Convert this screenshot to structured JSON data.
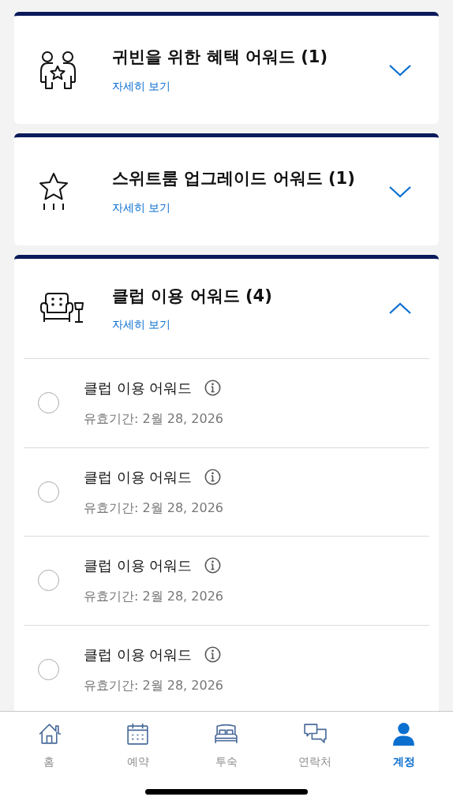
{
  "award_groups": [
    {
      "title": "귀빈을 위한 혜택 어워드 (1)",
      "link": "자세히 보기",
      "expanded": false
    },
    {
      "title": "스위트룸 업그레이드 어워드 (1)",
      "link": "자세히 보기",
      "expanded": false
    },
    {
      "title": "클럽 이용 어워드 (4)",
      "link": "자세히 보기",
      "expanded": true,
      "items": [
        {
          "name": "클럽 이용 어워드",
          "validity": "유효기간: 2월 28, 2026",
          "selected": false
        },
        {
          "name": "클럽 이용 어워드",
          "validity": "유효기간: 2월 28, 2026",
          "selected": false
        },
        {
          "name": "클럽 이용 어워드",
          "validity": "유효기간: 2월 28, 2026",
          "selected": false
        },
        {
          "name": "클럽 이용 어워드",
          "validity": "유효기간: 2월 28, 2026",
          "selected": false
        }
      ]
    }
  ],
  "tab_bar": [
    {
      "label": "홈",
      "selected": false
    },
    {
      "label": "예약",
      "selected": false
    },
    {
      "label": "투숙",
      "selected": false
    },
    {
      "label": "연락처",
      "selected": false
    },
    {
      "label": "계정",
      "selected": true
    }
  ]
}
